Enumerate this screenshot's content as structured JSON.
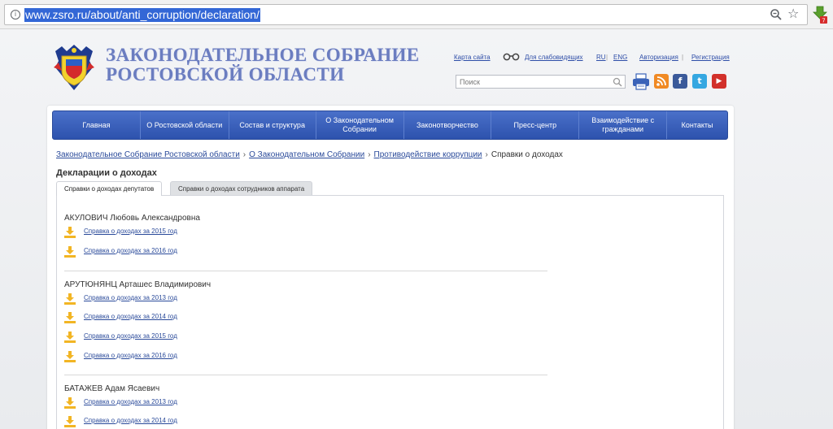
{
  "browser": {
    "url": "www.zsro.ru/about/anti_corruption/declaration/",
    "extension_badge": "7"
  },
  "header": {
    "title_line1": "ЗАКОНОДАТЕЛЬНОЕ СОБРАНИЕ",
    "title_line2": "РОСТОВСКОЙ ОБЛАСТИ",
    "links": {
      "sitemap": "Карта сайта",
      "accessibility": "Для слабовидящих",
      "ru": "RU",
      "eng": "ENG",
      "login": "Авторизация",
      "register": "Регистрация",
      "sep": "|"
    },
    "search_placeholder": "Поиск",
    "social": {
      "facebook": "f",
      "twitter": "t",
      "youtube": "▶"
    }
  },
  "nav": [
    "Главная",
    "О Ростовской области",
    "Состав и структура",
    "О Законодательном Собрании",
    "Законотворчество",
    "Пресс-центр",
    "Взаимодействие с гражданами",
    "Контакты"
  ],
  "breadcrumb": {
    "items": [
      "Законодательное Собрание Ростовской области",
      "О Законодательном Собрании",
      "Противодействие коррупции"
    ],
    "current": "Справки о доходах",
    "sep": "›"
  },
  "page_title": "Декларации о доходах",
  "tabs": [
    "Справки о доходах депутатов",
    "Справки о доходах сотрудников аппарата"
  ],
  "deputies": [
    {
      "name": "АКУЛОВИЧ Любовь Александровна",
      "docs": [
        "Справка о доходах за 2015 год",
        "Справка о доходах за 2016 год"
      ]
    },
    {
      "name": "АРУТЮНЯНЦ Арташес Владимирович",
      "docs": [
        "Справка о доходах за 2013 год",
        "Справка о доходах за 2014 год",
        "Справка о доходах за 2015 год",
        "Справка о доходах за 2016 год"
      ]
    },
    {
      "name": "БАТАЖЕВ Адам Ясаевич",
      "docs": [
        "Справка о доходах за 2013 год",
        "Справка о доходах за 2014 год"
      ]
    }
  ],
  "colors": {
    "nav": "#2d52ad",
    "title": "#6b7dc0",
    "link": "#2a4a9a",
    "download": "#f2b524",
    "url_highlight": "#3367d6"
  }
}
